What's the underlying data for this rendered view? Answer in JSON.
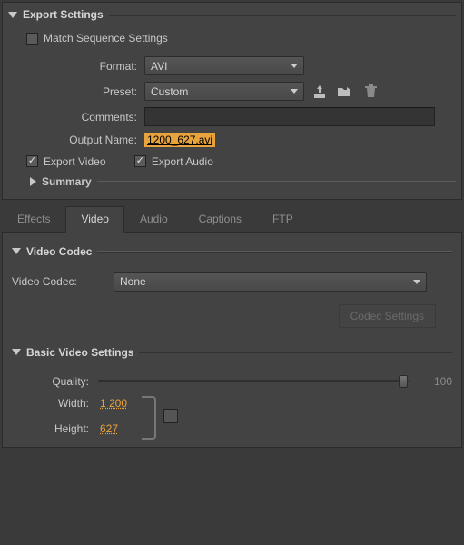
{
  "export": {
    "title": "Export Settings",
    "match_label": "Match Sequence Settings",
    "match_checked": false,
    "format_label": "Format:",
    "format_value": "AVI",
    "preset_label": "Preset:",
    "preset_value": "Custom",
    "comments_label": "Comments:",
    "comments_value": "",
    "output_label": "Output Name:",
    "output_value": "1200_627.avi",
    "export_video_label": "Export Video",
    "export_video_checked": true,
    "export_audio_label": "Export Audio",
    "export_audio_checked": true,
    "summary_label": "Summary"
  },
  "tabs": {
    "effects": "Effects",
    "video": "Video",
    "audio": "Audio",
    "captions": "Captions",
    "ftp": "FTP"
  },
  "codec": {
    "section_title": "Video Codec",
    "label": "Video Codec:",
    "value": "None",
    "settings_btn": "Codec Settings"
  },
  "basic": {
    "section_title": "Basic Video Settings",
    "quality_label": "Quality:",
    "quality_value": "100",
    "width_label": "Width:",
    "width_value": "1 200",
    "height_label": "Height:",
    "height_value": "627"
  }
}
